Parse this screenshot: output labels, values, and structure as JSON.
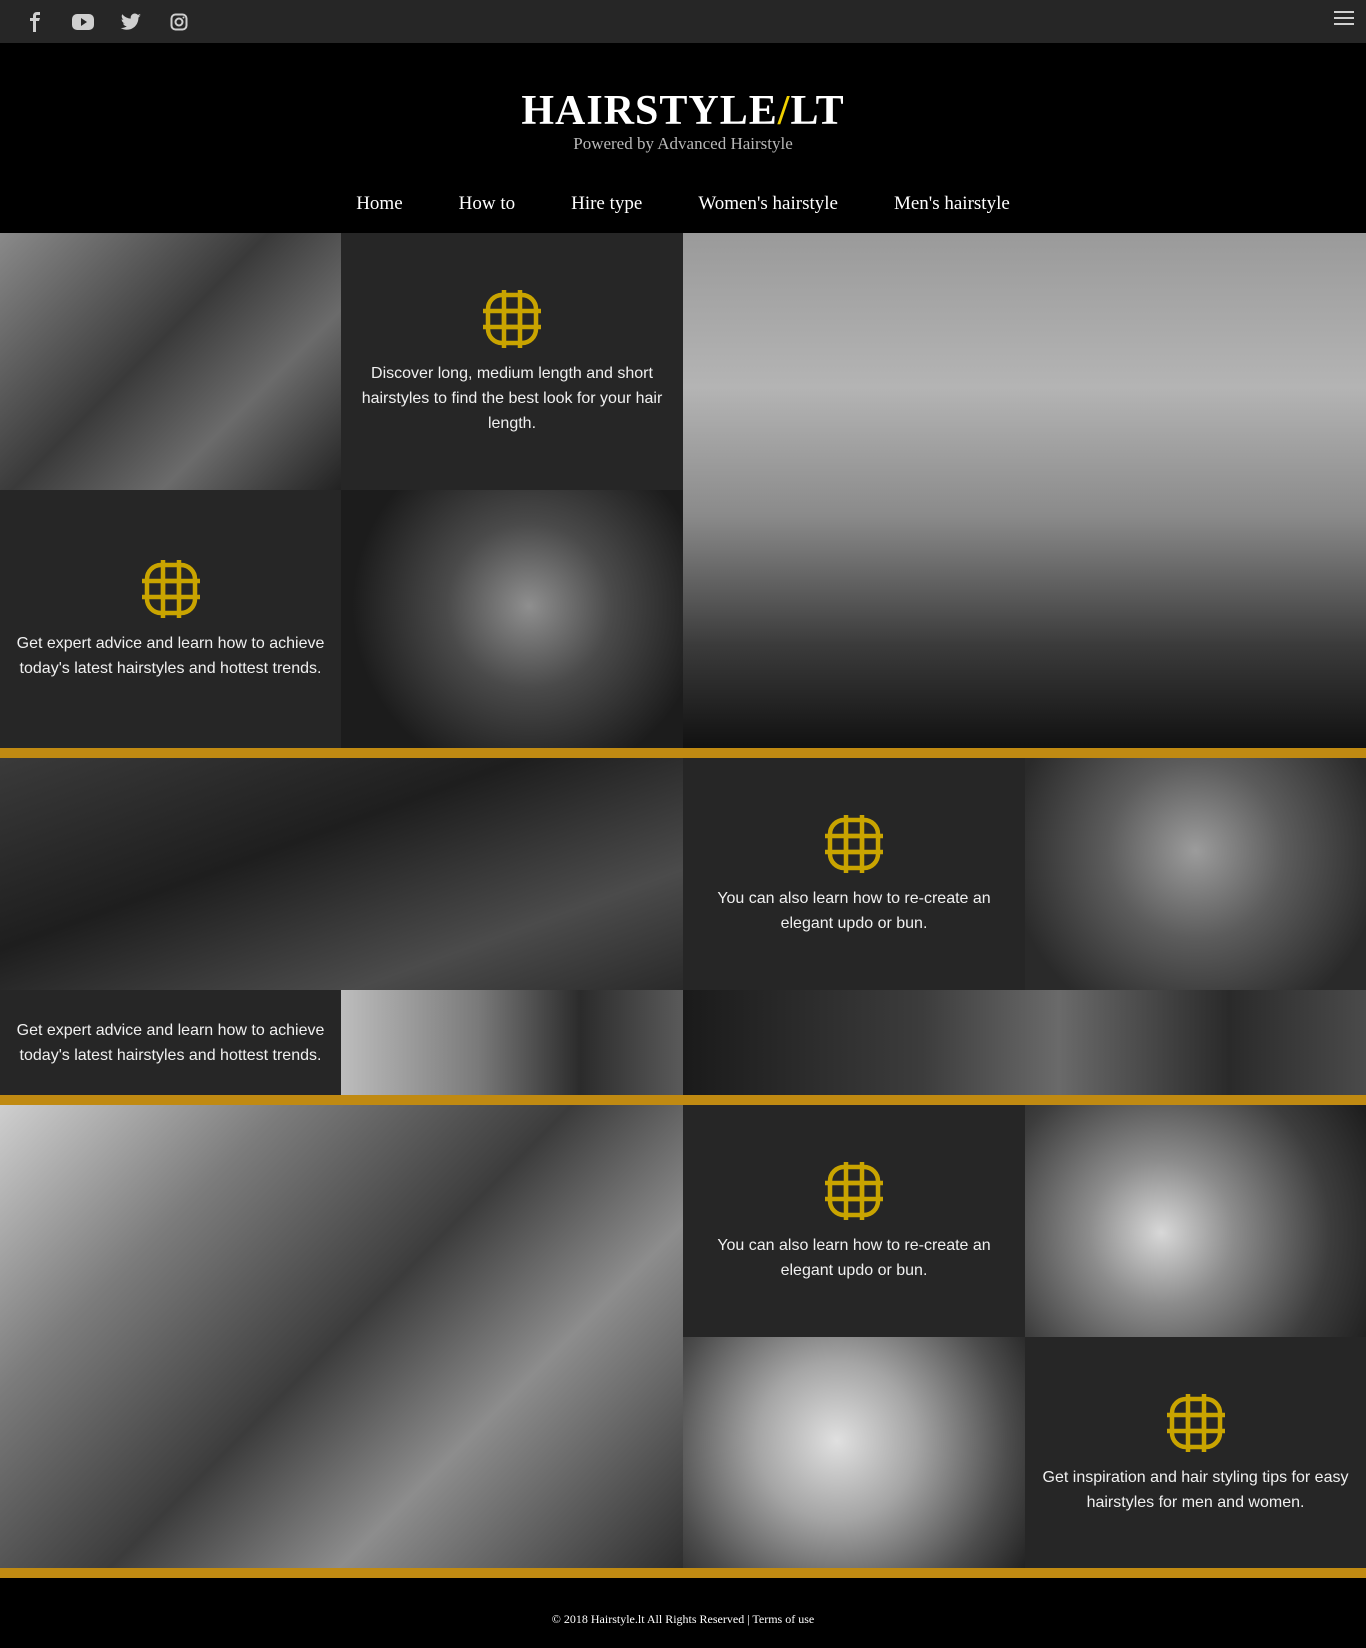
{
  "social": {
    "icons": [
      "facebook-icon",
      "youtube-icon",
      "twitter-icon",
      "instagram-icon"
    ]
  },
  "menu_icon": "hamburger-menu-icon",
  "brand": {
    "name_part1": "HAIRSTYLE",
    "slash": "/",
    "name_part2": "LT",
    "tagline": "Powered by Advanced Hairstyle",
    "accent_color": "#f1d100"
  },
  "nav": {
    "items": [
      "Home",
      "How to",
      "Hire type",
      "Women's hairstyle",
      "Men's hairstyle"
    ]
  },
  "section1": {
    "box1_text": "Discover long, medium length and short hairstyles to find the best look for your hair length.",
    "box2_text": "Get expert advice and learn how to achieve today's latest hairstyles and hottest trends."
  },
  "section2": {
    "box1_text": "You can also learn how to re-create an elegant updo or bun.",
    "box2_text": "Get expert advice and learn how to achieve today's latest hairstyles and hottest trends."
  },
  "section3": {
    "box1_text": "You can also learn how to re-create an elegant updo or bun.",
    "box2_text": "Get inspiration and hair styling tips for easy hairstyles for men and women."
  },
  "footer": {
    "copyright": "© 2018 Hairstyle.lt All Rights Reserved |",
    "terms": "Terms of use"
  },
  "colors": {
    "gold_band": "#c08a12",
    "emblem": "#c9a400",
    "dark_tile": "#262626"
  }
}
